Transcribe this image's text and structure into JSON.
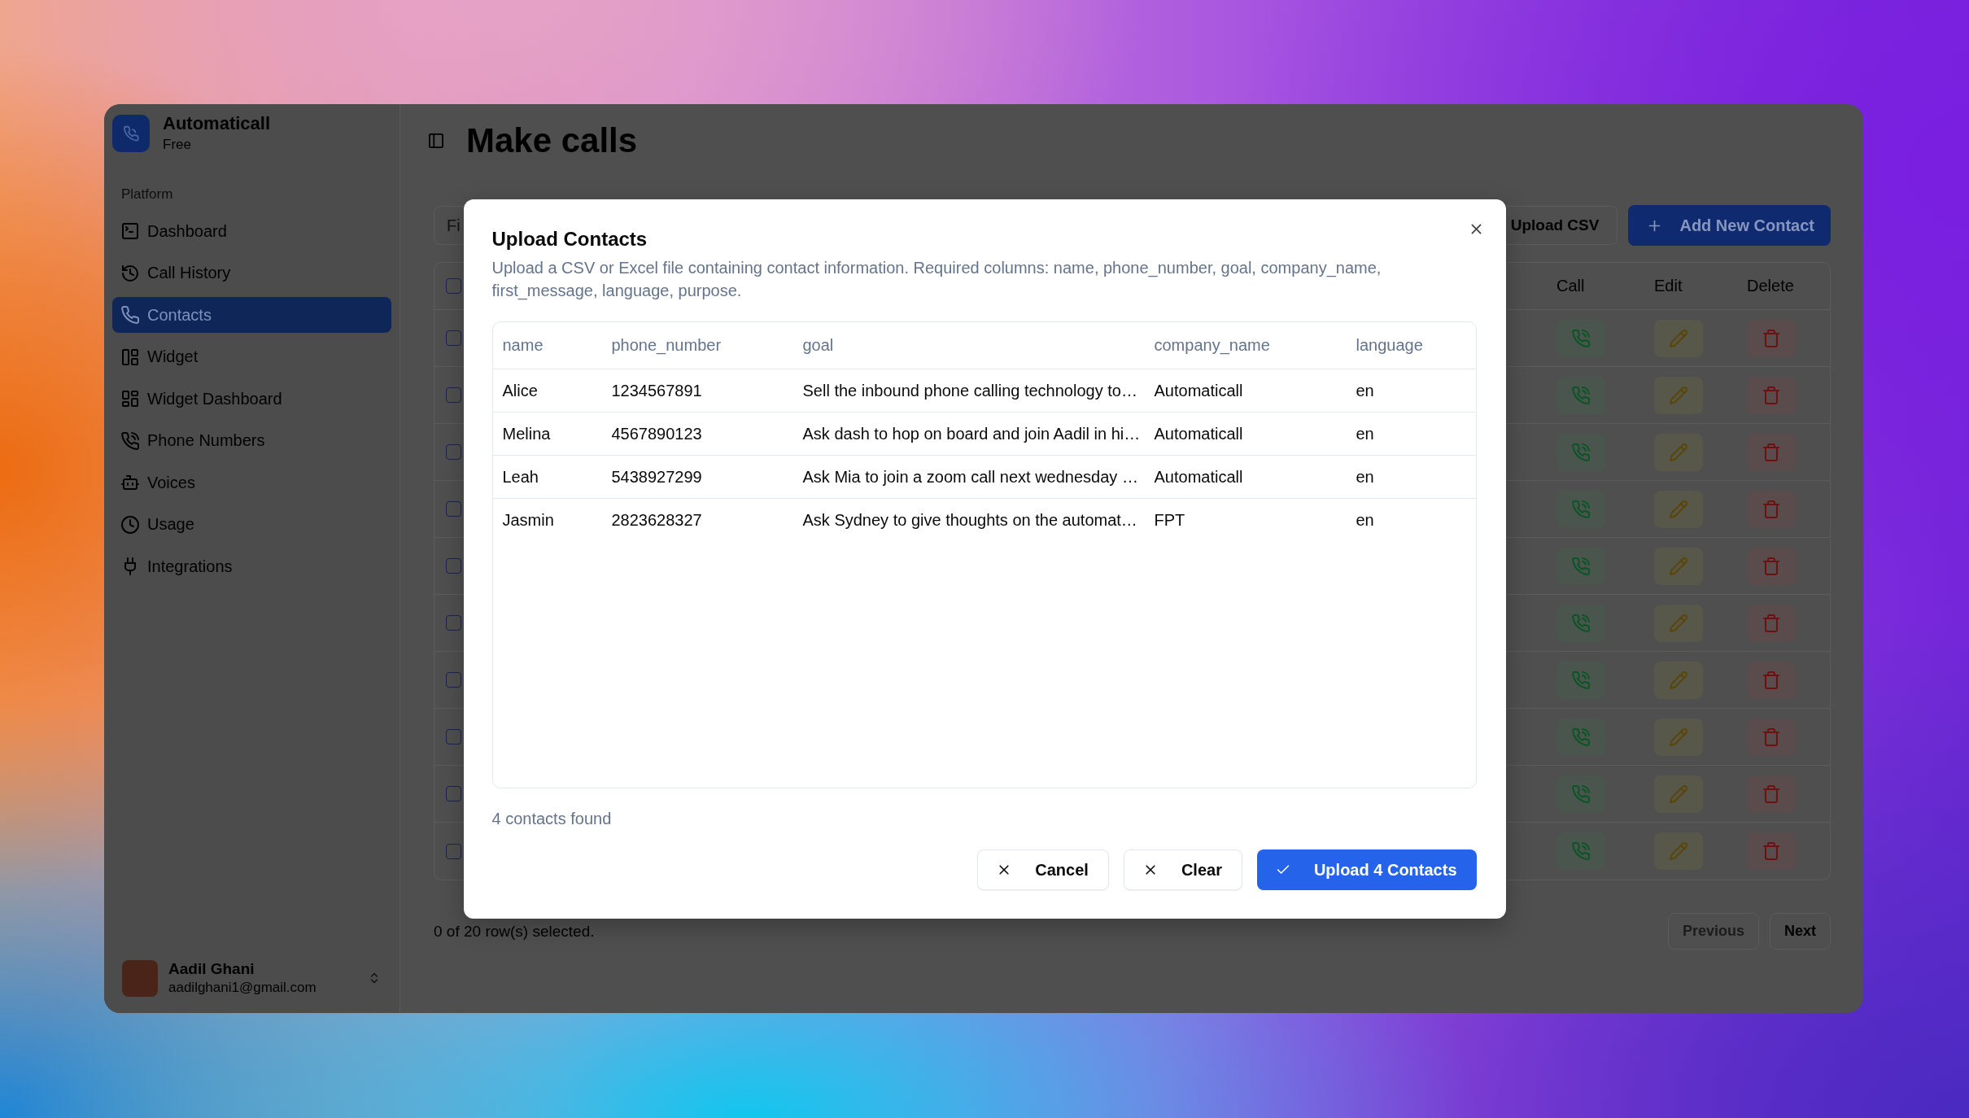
{
  "sidebar": {
    "brand": {
      "name": "Automaticall",
      "plan": "Free"
    },
    "section_label": "Platform",
    "items": [
      {
        "label": "Dashboard",
        "selected": false
      },
      {
        "label": "Call History",
        "selected": false
      },
      {
        "label": "Contacts",
        "selected": true
      },
      {
        "label": "Widget",
        "selected": false
      },
      {
        "label": "Widget Dashboard",
        "selected": false
      },
      {
        "label": "Phone Numbers",
        "selected": false
      },
      {
        "label": "Voices",
        "selected": false
      },
      {
        "label": "Usage",
        "selected": false
      },
      {
        "label": "Integrations",
        "selected": false
      }
    ],
    "user": {
      "name": "Aadil Ghani",
      "email": "aadilghani1@gmail.com"
    }
  },
  "header": {
    "title": "Make calls"
  },
  "toolbar": {
    "filter": {
      "placeholder": "Fi"
    },
    "buttons": [
      {
        "label": "Upload CSV",
        "kind": "outline"
      },
      {
        "label": "Add New Contact",
        "kind": "primary"
      }
    ]
  },
  "contacts_table": {
    "header_checked": false,
    "columns": [
      "Call",
      "Edit",
      "Delete"
    ],
    "rows": [
      {
        "checked": false
      },
      {
        "checked": false
      },
      {
        "checked": false
      },
      {
        "checked": false
      },
      {
        "checked": false
      },
      {
        "checked": false
      },
      {
        "checked": false
      },
      {
        "checked": false
      },
      {
        "checked": false
      },
      {
        "checked": false
      }
    ]
  },
  "footer": {
    "selection": "0 of 20 row(s) selected.",
    "pagination": [
      {
        "label": "Previous",
        "disabled": true
      },
      {
        "label": "Next",
        "disabled": false
      }
    ]
  },
  "dialog": {
    "title": "Upload Contacts",
    "description": "Upload a CSV or Excel file containing contact information. Required columns: name, phone_number, goal, company_name, first_message, language, purpose.",
    "preview": {
      "columns": [
        "name",
        "phone_number",
        "goal",
        "company_name",
        "language"
      ],
      "rows": [
        [
          "Alice",
          "1234567891",
          "Sell the inbound phone calling technology to…",
          "Automaticall",
          "en"
        ],
        [
          "Melina",
          "4567890123",
          "Ask dash to hop on board and join Aadil in hi…",
          "Automaticall",
          "en"
        ],
        [
          "Leah",
          "5438927299",
          "Ask Mia to join a zoom call next wednesday …",
          "Automaticall",
          "en"
        ],
        [
          "Jasmin",
          "2823628327",
          "Ask Sydney to give thoughts on the automat…",
          "FPT",
          "en"
        ]
      ]
    },
    "summary": "4 contacts found",
    "buttons": [
      {
        "label": "Cancel",
        "kind": "outline"
      },
      {
        "label": "Clear",
        "kind": "outline"
      },
      {
        "label": "Upload 4 Contacts",
        "kind": "primary"
      }
    ]
  }
}
